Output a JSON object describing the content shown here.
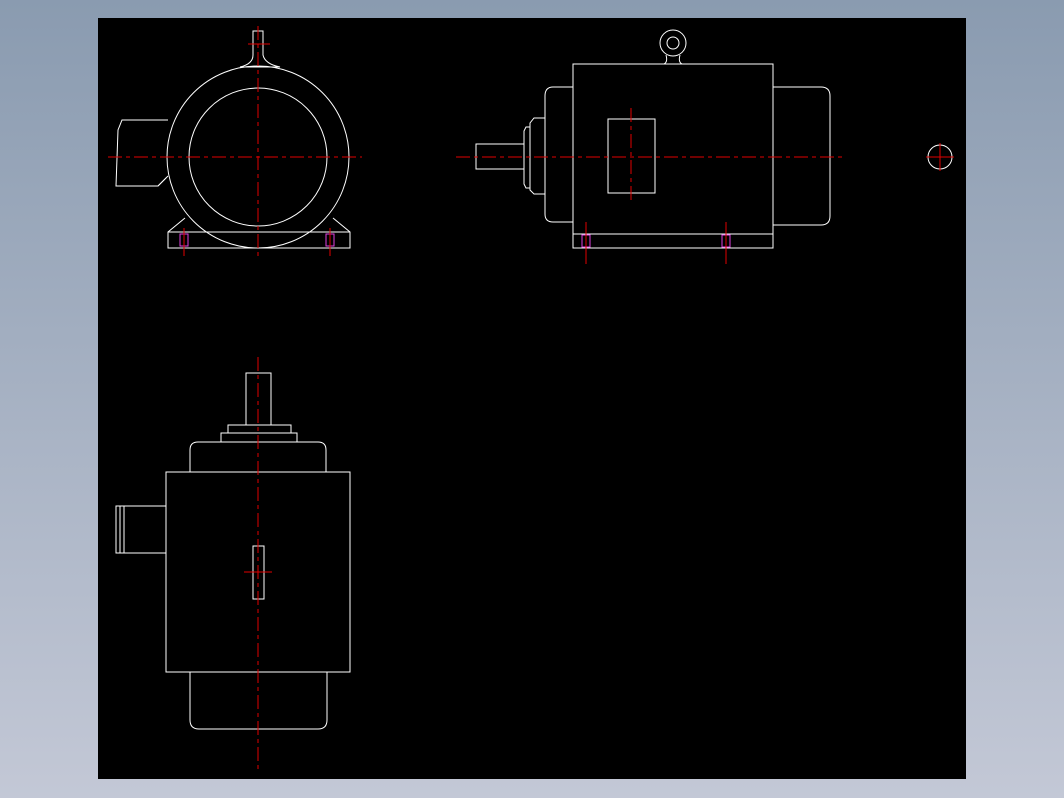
{
  "colors": {
    "background_top": "#8a9bb0",
    "background_bottom": "#c3c8d6",
    "canvas": "#000000",
    "outline": "#ffffff",
    "centerline": "#e00000",
    "bolt_hole": "#e040e0"
  },
  "views": [
    "front-view",
    "side-view",
    "top-view",
    "detail-circle"
  ]
}
